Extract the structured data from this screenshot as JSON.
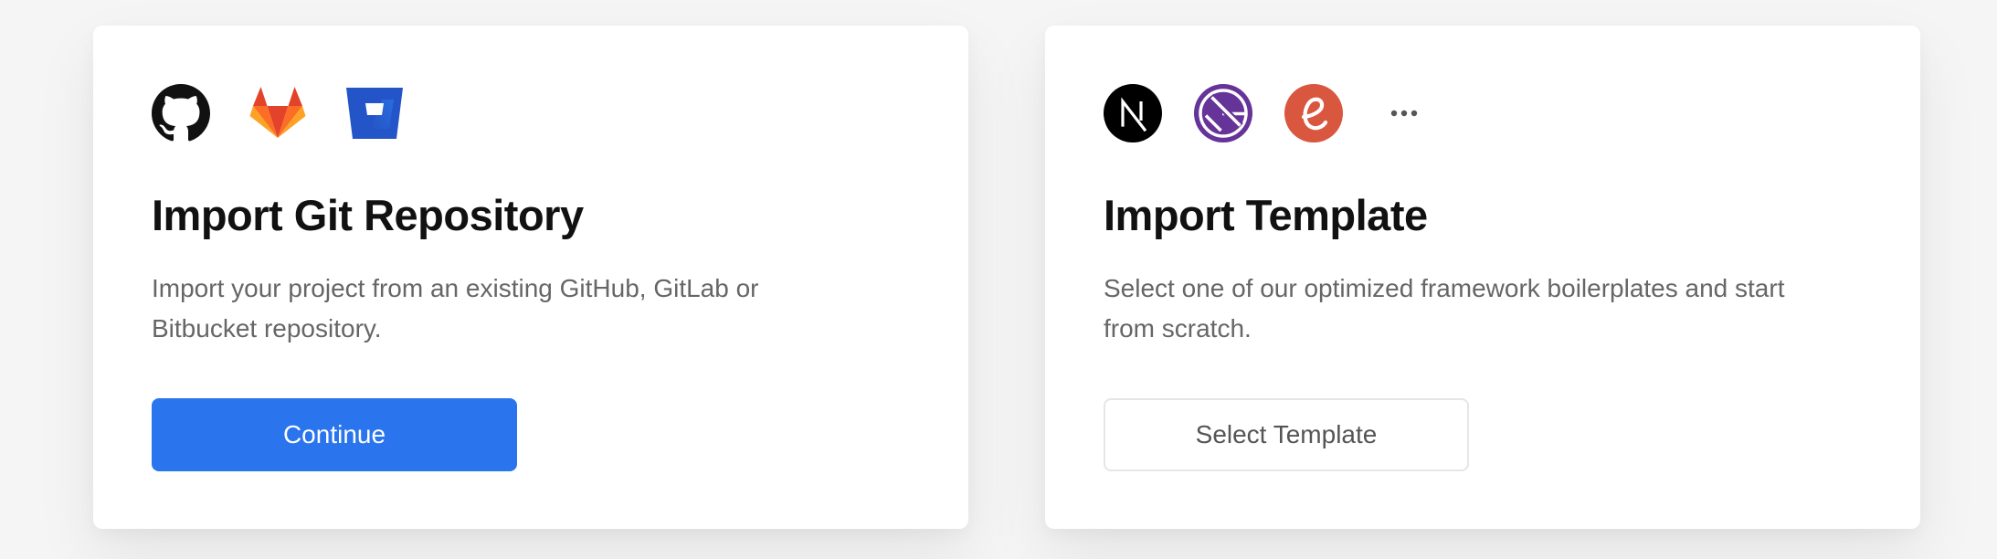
{
  "git_card": {
    "title": "Import Git Repository",
    "description": "Import your project from an existing GitHub, GitLab or Bitbucket repository.",
    "button_label": "Continue",
    "icons": [
      "github-icon",
      "gitlab-icon",
      "bitbucket-icon"
    ]
  },
  "template_card": {
    "title": "Import Template",
    "description": "Select one of our optimized framework boilerplates and start from scratch.",
    "button_label": "Select Template",
    "icons": [
      "nextjs-icon",
      "gatsby-icon",
      "eleventy-icon",
      "more-icon"
    ]
  },
  "colors": {
    "primary_button": "#2a74ed",
    "github": "#111111",
    "gitlab": "#e2432a",
    "bitbucket": "#2455c8",
    "nextjs": "#000000",
    "gatsby": "#663399",
    "eleventy": "#d9573f"
  }
}
